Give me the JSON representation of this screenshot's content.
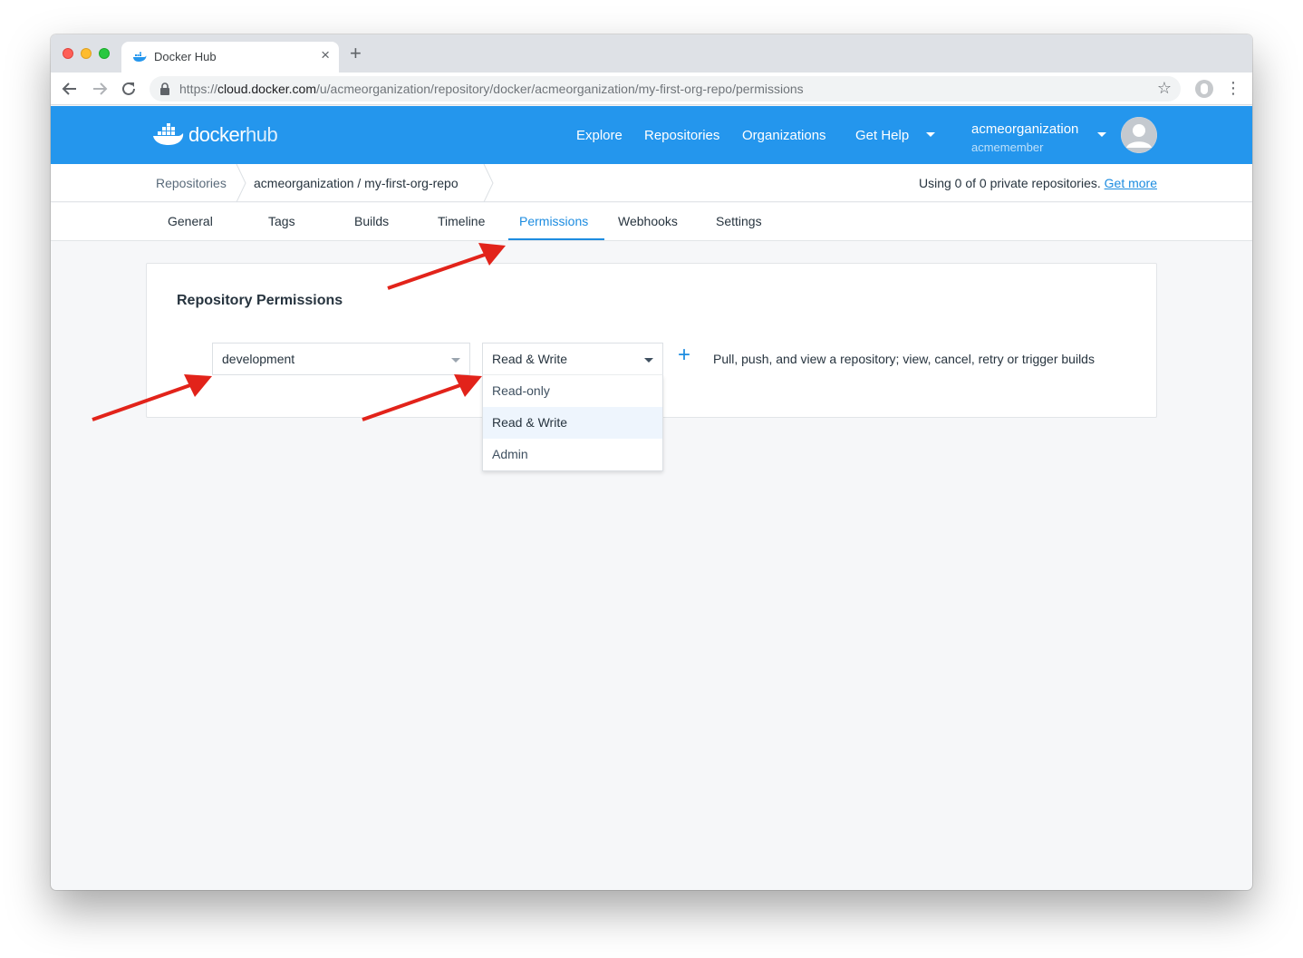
{
  "browser": {
    "tab_title": "Docker Hub",
    "url_scheme": "https://",
    "url_host": "cloud.docker.com",
    "url_path": "/u/acmeorganization/repository/docker/acmeorganization/my-first-org-repo/permissions"
  },
  "header": {
    "logo_docker": "docker",
    "logo_hub": "hub",
    "nav": [
      "Explore",
      "Repositories",
      "Organizations",
      "Get Help"
    ],
    "org_name": "acmeorganization",
    "user_name": "acmemember"
  },
  "breadcrumb": {
    "root": "Repositories",
    "current": "acmeorganization / my-first-org-repo"
  },
  "usage": {
    "text": "Using 0 of 0 private repositories.",
    "link": "Get more"
  },
  "subtabs": {
    "items": [
      "General",
      "Tags",
      "Builds",
      "Timeline",
      "Permissions",
      "Webhooks",
      "Settings"
    ],
    "active": "Permissions"
  },
  "permissions": {
    "title": "Repository Permissions",
    "team_value": "development",
    "permission_value": "Read & Write",
    "description": "Pull, push, and view a repository; view, cancel, retry or trigger builds",
    "options": [
      "Read-only",
      "Read & Write",
      "Admin"
    ],
    "selected_option": "Read & Write"
  },
  "colors": {
    "brand_blue": "#2496ed",
    "accent_blue": "#1d8ce0",
    "annotation_red": "#e2231a"
  }
}
